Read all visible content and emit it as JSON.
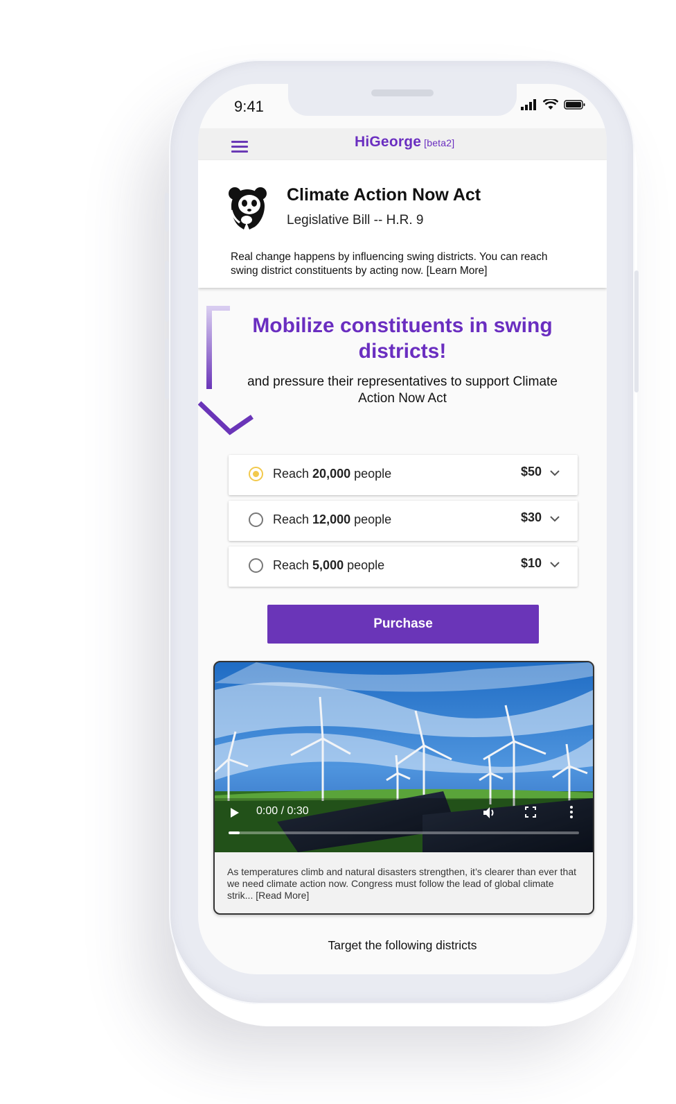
{
  "status": {
    "time": "9:41"
  },
  "app": {
    "logo": "HiGeorge",
    "beta": "[beta2]"
  },
  "bill": {
    "title": "Climate Action Now Act",
    "subtitle": "Legislative Bill -- H.R. 9",
    "description": "Real change happens by influencing swing districts. You can reach swing district constituents by acting now. [Learn More]"
  },
  "campaign": {
    "headline": "Mobilize constituents in swing districts!",
    "subline": "and pressure their representatives to support Climate Action Now Act"
  },
  "options": [
    {
      "prefix": "Reach ",
      "count": "20,000",
      "suffix": " people",
      "price": "$50",
      "selected": true
    },
    {
      "prefix": "Reach ",
      "count": "12,000",
      "suffix": " people",
      "price": "$30",
      "selected": false
    },
    {
      "prefix": "Reach ",
      "count": "5,000",
      "suffix": " people",
      "price": "$10",
      "selected": false
    }
  ],
  "purchase_label": "Purchase",
  "video": {
    "time": "0:00 / 0:30",
    "progress": 0.0,
    "description": "As temperatures climb and natural disasters strengthen, it’s clearer than ever that we need climate action now. Congress must follow the lead of global climate strik... [Read More]"
  },
  "target_label": "Target the following districts",
  "colors": {
    "brand": "#6a35b8",
    "accent": "#f2c94c"
  }
}
